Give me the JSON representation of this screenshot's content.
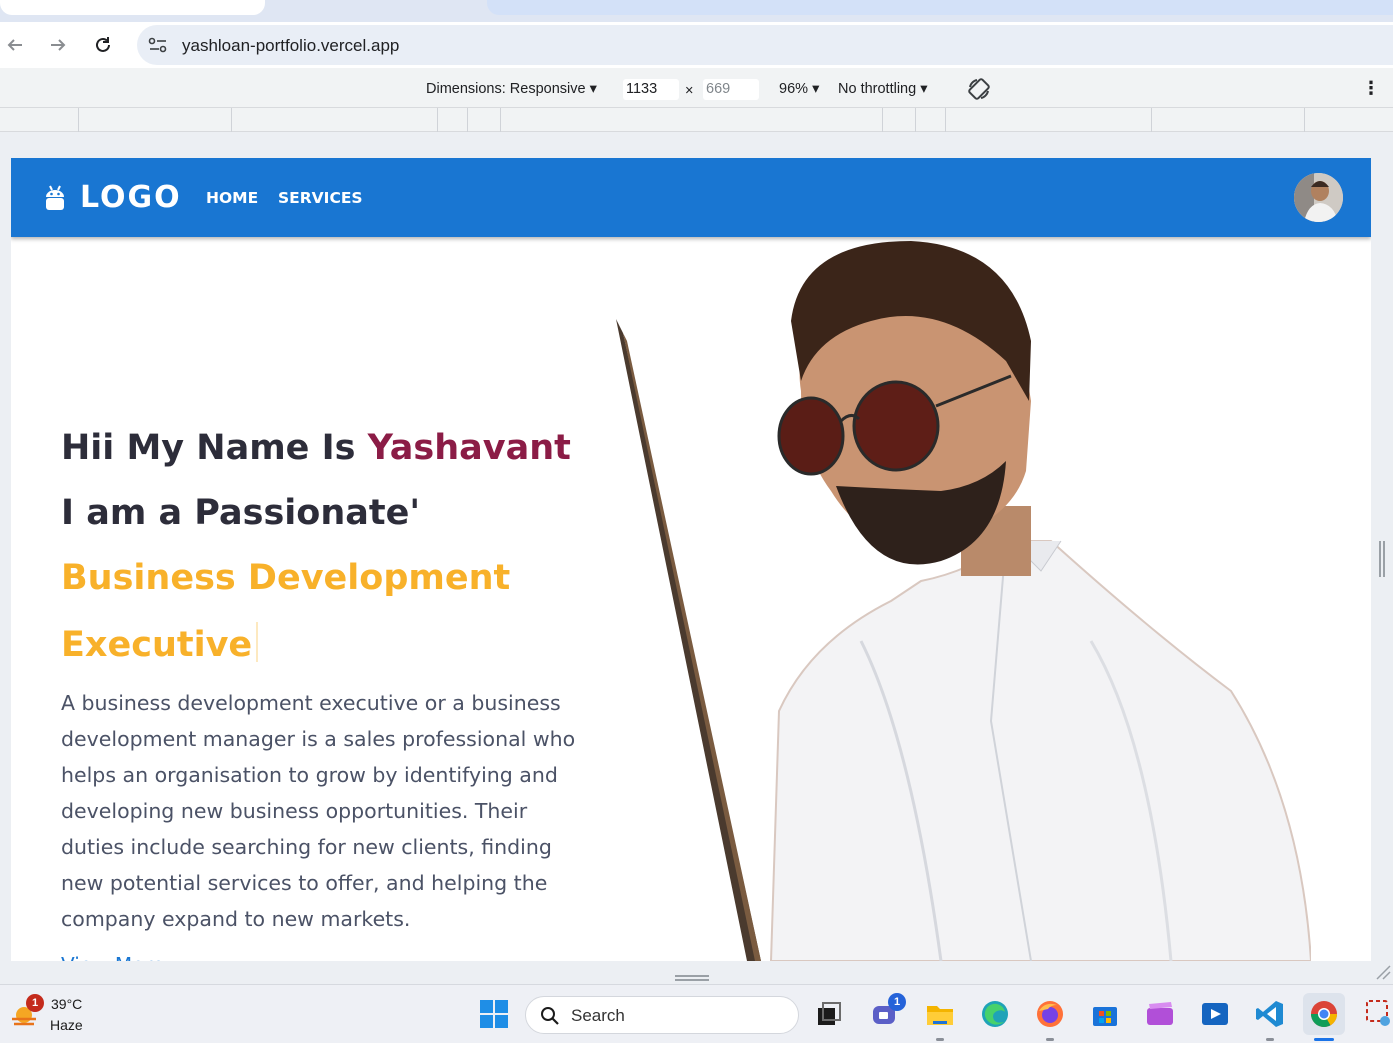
{
  "browser": {
    "url": "yashloan-portfolio.vercel.app",
    "back_icon": "arrow-left-icon",
    "forward_icon": "arrow-right-icon",
    "reload_icon": "reload-icon"
  },
  "devtools": {
    "dimensions_label": "Dimensions: Responsive",
    "width_value": "1133",
    "times": "×",
    "height_value": "669",
    "zoom": "96%",
    "throttling": "No throttling",
    "more_icon": "⋮"
  },
  "site": {
    "logo_text": "LOGO",
    "nav": [
      {
        "label": "HOME"
      },
      {
        "label": "SERVICES"
      }
    ],
    "hero": {
      "line1_prefix": "Hii My Name Is ",
      "line1_name": "Yashavant",
      "line2": "I am a Passionate'",
      "role_line1": "Business Development",
      "role_line2": "Executive",
      "description": "A business development executive or a business development manager is a sales professional who helps an organisation to grow by identifying and developing new business opportunities. Their duties include searching for new clients, finding new potential services to offer, and helping the company expand to new markets.",
      "cta": "View More"
    },
    "colors": {
      "navbar": "#1976d2",
      "name_accent": "#8b1c46",
      "role_accent": "#f8b12a",
      "heading": "#2d2d3a",
      "body_text": "#4b5266"
    }
  },
  "taskbar": {
    "weather_temp": "39°C",
    "weather_cond": "Haze",
    "weather_badge": "1",
    "search_label": "Search",
    "teams_badge": "1",
    "apps": [
      "start-icon",
      "task-view-icon",
      "teams-icon",
      "file-explorer-icon",
      "edge-icon",
      "firefox-icon",
      "store-icon",
      "clipchamp-icon",
      "media-player-icon",
      "vscode-icon",
      "chrome-icon",
      "snipping-tool-icon"
    ]
  }
}
